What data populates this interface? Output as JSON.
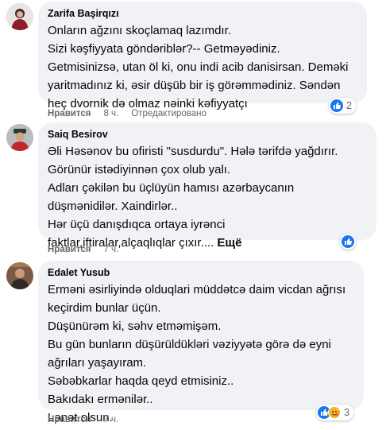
{
  "comments": [
    {
      "author": "Zarifa Başirqızı",
      "text": "Onların ağzını skoçlamaq lazımdır.\nSizi kəşfiyyata göndəriblər?-- Getməyədiniz.\nGetmisinizsə, utan öl ki, onu indi acib danisirsan. Deməki\nyaritmadınız ki, əsir düşüb bir iş görəmmədiniz. Səndən\nheç dvornik də olmaz nəinki kəfiyyatçı",
      "like_label": "Нравится",
      "time": "8 ч.",
      "reply_label": "Отредактировано",
      "reaction_count": "2"
    },
    {
      "author": "Saiq Besirov",
      "text": "Əli Həsənov bu ofiristi \"susdurdu\". Hələ tərifdə yağdırır.\nGörünür istədiyinnən çox olub yalı.\nAdları çəkilən bu üçlüyün hamısı azərbaycanın\ndüşmənidilər. Xaindirlər..\nHər üçü danışdıqca ortaya iyrənci\nfaktlar,iftiralar,alçaqlıqlar çıxır....",
      "more_label": "Ещё",
      "like_label": "Нравится",
      "time": "7 ч.",
      "reaction_count": ""
    },
    {
      "author": "Edalet Yusub",
      "text": "Erməni əsirliyində olduqlari müddətcə daim vicdan ağrısı\nkeçirdim bunlar üçün.\nDüşünürəm ki, səhv etməmişəm.\nBu gün bunların düşürüldükləri vəziyyətə görə də eyni\nağrıları yaşayıram.\nSəbəbkarlar haqda qeyd etmisiniz..\nBakıdakı ermənilər..\nLənət olsun.",
      "like_label": "Нравится",
      "time": "7 ч.",
      "reaction_count": "3"
    }
  ],
  "colors": {
    "like_blue": "#1877f2",
    "bubble_bg": "#f0f2f5",
    "muted": "#65676b"
  },
  "icons": {
    "like": "thumbs-up-icon",
    "care": "care-emoji-icon"
  }
}
